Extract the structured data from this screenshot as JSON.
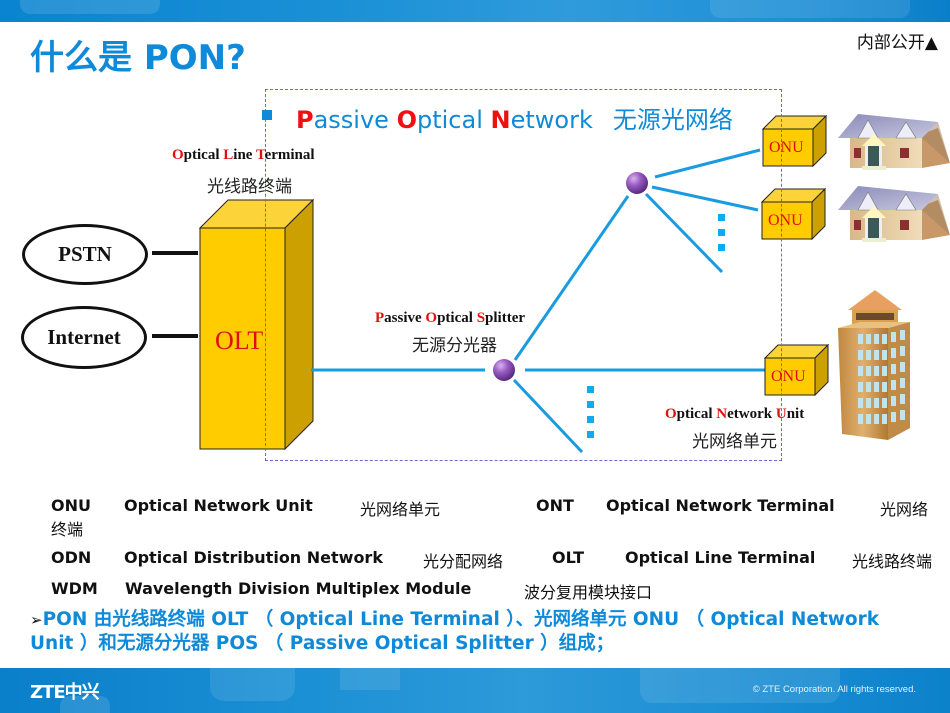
{
  "header": {
    "title": "什么是 PON?",
    "classification": "内部公开▲"
  },
  "diagram": {
    "heading": {
      "parts": [
        {
          "text": "P",
          "red": true
        },
        {
          "text": "assive ",
          "red": false
        },
        {
          "text": "O",
          "red": true
        },
        {
          "text": "ptical ",
          "red": false
        },
        {
          "text": "N",
          "red": true
        },
        {
          "text": "etwork",
          "red": false
        }
      ],
      "cn": "无源光网络"
    },
    "olt": {
      "label": "OLT",
      "title_parts": [
        {
          "text": "O",
          "red": true
        },
        {
          "text": "ptical ",
          "red": false
        },
        {
          "text": "L",
          "red": true
        },
        {
          "text": "ine ",
          "red": false
        },
        {
          "text": "T",
          "red": true
        },
        {
          "text": "erminal",
          "red": false
        }
      ],
      "cn": "光线路终端"
    },
    "networks": [
      {
        "label": "PSTN"
      },
      {
        "label": "Internet"
      }
    ],
    "splitter": {
      "title_parts": [
        {
          "text": "P",
          "red": true
        },
        {
          "text": "assive ",
          "red": false
        },
        {
          "text": "O",
          "red": true
        },
        {
          "text": "ptical ",
          "red": false
        },
        {
          "text": "S",
          "red": true
        },
        {
          "text": "plitter",
          "red": false
        }
      ],
      "cn": "无源分光器"
    },
    "onus": [
      {
        "label": "ONU",
        "premise": "house"
      },
      {
        "label": "ONU",
        "premise": "house"
      },
      {
        "label": "ONU",
        "premise": "office-building"
      }
    ],
    "onu_caption": {
      "title_parts": [
        {
          "text": "O",
          "red": true
        },
        {
          "text": "ptical ",
          "red": false
        },
        {
          "text": "N",
          "red": true
        },
        {
          "text": "etwork ",
          "red": false
        },
        {
          "text": "U",
          "red": true
        },
        {
          "text": "nit",
          "red": false
        }
      ],
      "cn": "光网络单元"
    },
    "colors": {
      "fiber": "#1a9be0",
      "box_yellow": "#ffcc00",
      "box_side": "#d4a600",
      "splitter": "#8a4fb0",
      "ellipsis_dots": "#11aaee"
    }
  },
  "glossary": [
    {
      "abbr": "ONU",
      "full": "Optical Network Unit",
      "cn": "光网络单元"
    },
    {
      "abbr": "ONT",
      "full": "Optical Network Terminal",
      "cn": "光网络终端"
    },
    {
      "abbr": "ODN",
      "full": "Optical Distribution Network",
      "cn": "光分配网络"
    },
    {
      "abbr": "OLT",
      "full": "Optical Line Terminal",
      "cn": "光线路终端"
    },
    {
      "abbr": "WDM",
      "full": "Wavelength Division Multiplex Module",
      "cn": "波分复用模块接口"
    }
  ],
  "glossary_wrap": {
    "ont_cn_line1": "光网络",
    "ont_cn_line2": "终端"
  },
  "summary": {
    "bullet": "➢",
    "text": "PON 由光线路终端 OLT （ Optical Line Terminal ）、光网络单元  ONU  （  Optical Network Unit ）和无源分光器 POS （ Passive Optical Splitter ）组成；"
  },
  "footer": {
    "logo": "ZTE中兴",
    "copyright": "© ZTE Corporation. All rights reserved."
  }
}
